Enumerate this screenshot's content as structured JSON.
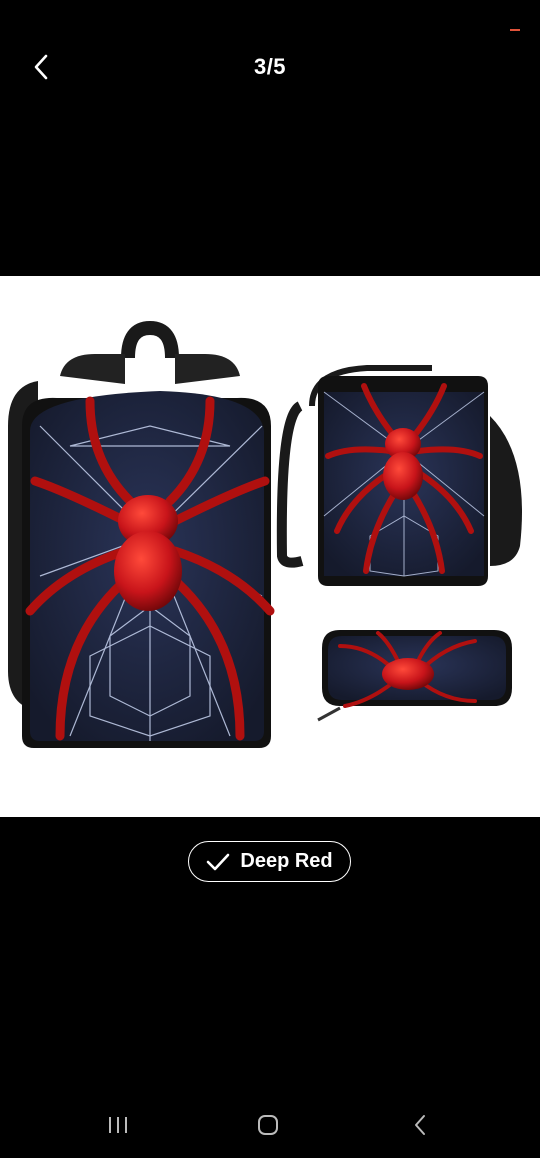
{
  "header": {
    "back_icon": "chevron-left-icon",
    "counter": "3/5"
  },
  "product_image": {
    "description_items": [
      "backpack",
      "lunch-bag",
      "pencil-case"
    ],
    "accent_color": "#d01818",
    "fabric_color": "#1c2238"
  },
  "variant": {
    "icon": "checkmark-icon",
    "label": "Deep Red"
  },
  "system_nav": {
    "recents_icon": "recents-icon",
    "home_icon": "home-icon",
    "back_icon": "back-icon"
  }
}
